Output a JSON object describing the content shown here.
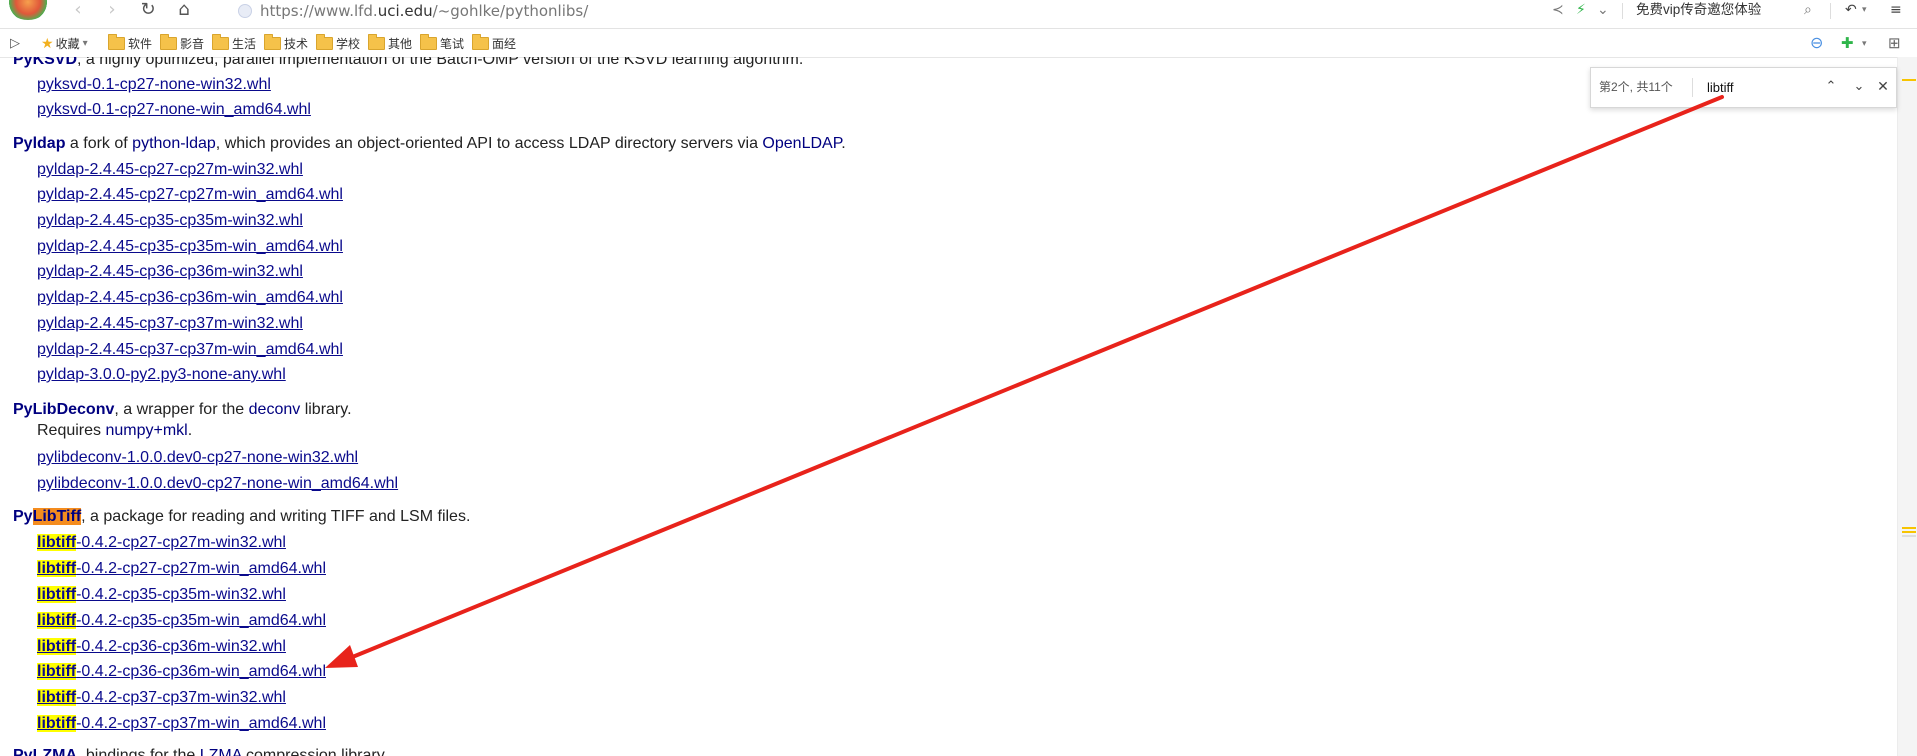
{
  "toolbar": {
    "url_host_pre": "https://www.lfd.",
    "url_host_main": "uci.edu",
    "url_path": "/~gohlke/pythonlibs/",
    "ad_text": "免费vip传奇邀您体验"
  },
  "bookmarks": {
    "favorites_label": "收藏",
    "folders": [
      "软件",
      "影音",
      "生活",
      "技术",
      "学校",
      "其他",
      "笔试",
      "面经"
    ]
  },
  "find": {
    "count": "第2个, 共11个",
    "query": "libtiff"
  },
  "content": {
    "pyksvd": {
      "name": "PyKSVD",
      "desc": ", a highly optimized, parallel implementation of the Batch-OMP version of the KSVD learning algorithm.",
      "files": [
        "pyksvd-0.1-cp27-none-win32.whl",
        "pyksvd-0.1-cp27-none-win_amd64.whl"
      ]
    },
    "pyldap": {
      "name": "Pyldap",
      "t1": " a fork of ",
      "ref1": "python-ldap",
      "t2": ", which provides an object-oriented API to access LDAP directory servers via ",
      "ref2": "OpenLDAP",
      "t3": ".",
      "files": [
        "pyldap-2.4.45-cp27-cp27m-win32.whl",
        "pyldap-2.4.45-cp27-cp27m-win_amd64.whl",
        "pyldap-2.4.45-cp35-cp35m-win32.whl",
        "pyldap-2.4.45-cp35-cp35m-win_amd64.whl",
        "pyldap-2.4.45-cp36-cp36m-win32.whl",
        "pyldap-2.4.45-cp36-cp36m-win_amd64.whl",
        "pyldap-2.4.45-cp37-cp37m-win32.whl",
        "pyldap-2.4.45-cp37-cp37m-win_amd64.whl",
        "pyldap-3.0.0-py2.py3-none-any.whl"
      ]
    },
    "pylibdeconv": {
      "name": "PyLibDeconv",
      "t1": ", a wrapper for the ",
      "ref1": "deconv",
      "t2": " library.",
      "req_text": "Requires ",
      "req_ref": "numpy+mkl",
      "req_end": ".",
      "files": [
        "pylibdeconv-1.0.0.dev0-cp27-none-win32.whl",
        "pylibdeconv-1.0.0.dev0-cp27-none-win_amd64.whl"
      ]
    },
    "pylibtiff": {
      "name_pre": "Py",
      "name_hl": "LibTiff",
      "desc": ", a package for reading and writing TIFF and LSM files.",
      "match": "libtiff",
      "suffixes": [
        "-0.4.2-cp27-cp27m-win32.whl",
        "-0.4.2-cp27-cp27m-win_amd64.whl",
        "-0.4.2-cp35-cp35m-win32.whl",
        "-0.4.2-cp35-cp35m-win_amd64.whl",
        "-0.4.2-cp36-cp36m-win32.whl",
        "-0.4.2-cp36-cp36m-win_amd64.whl",
        "-0.4.2-cp37-cp37m-win32.whl",
        "-0.4.2-cp37-cp37m-win_amd64.whl"
      ]
    },
    "pylzma": {
      "name": "PyLZMA",
      "t1": ", bindings for the ",
      "ref1": "LZMA",
      "t2": " compression library."
    }
  },
  "colors": {
    "link": "#0a0a8c",
    "highlight": "#ffff00",
    "current_match": "#f48c1e",
    "arrow": "#e8231b"
  }
}
